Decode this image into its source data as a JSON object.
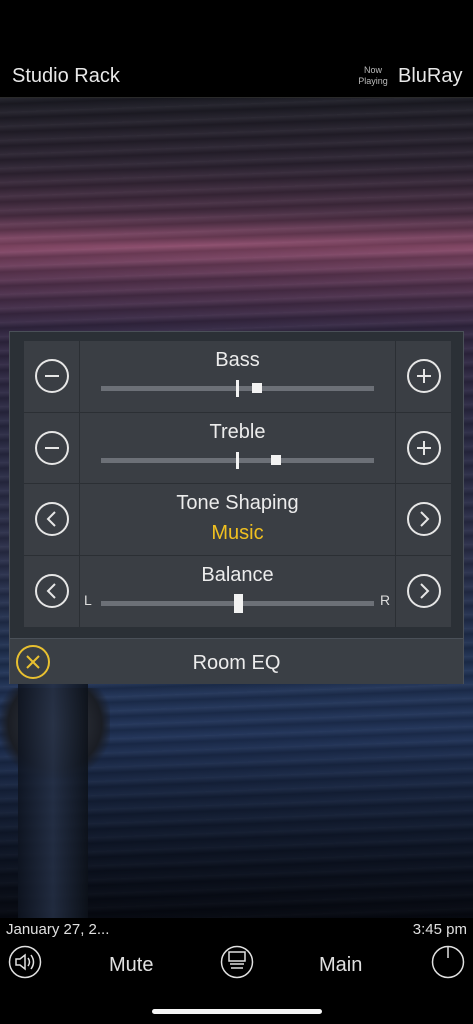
{
  "header": {
    "room": "Studio Rack",
    "now_playing_line1": "Now",
    "now_playing_line2": "Playing",
    "source": "BluRay"
  },
  "tone": {
    "bass": {
      "label": "Bass",
      "level": 0.57
    },
    "treble": {
      "label": "Treble",
      "level": 0.64
    },
    "tone_shaping": {
      "label": "Tone Shaping",
      "value": "Music"
    },
    "balance": {
      "label": "Balance",
      "left": "L",
      "right": "R",
      "level": 0.5
    }
  },
  "room_eq": {
    "label": "Room EQ"
  },
  "footer": {
    "date": "January 27, 2...",
    "time": "3:45 pm",
    "mute_label": "Mute",
    "main_label": "Main"
  },
  "colors": {
    "accent": "#f0c020",
    "panel_bg": "#2b3036",
    "row_bg": "#3a3e44"
  }
}
